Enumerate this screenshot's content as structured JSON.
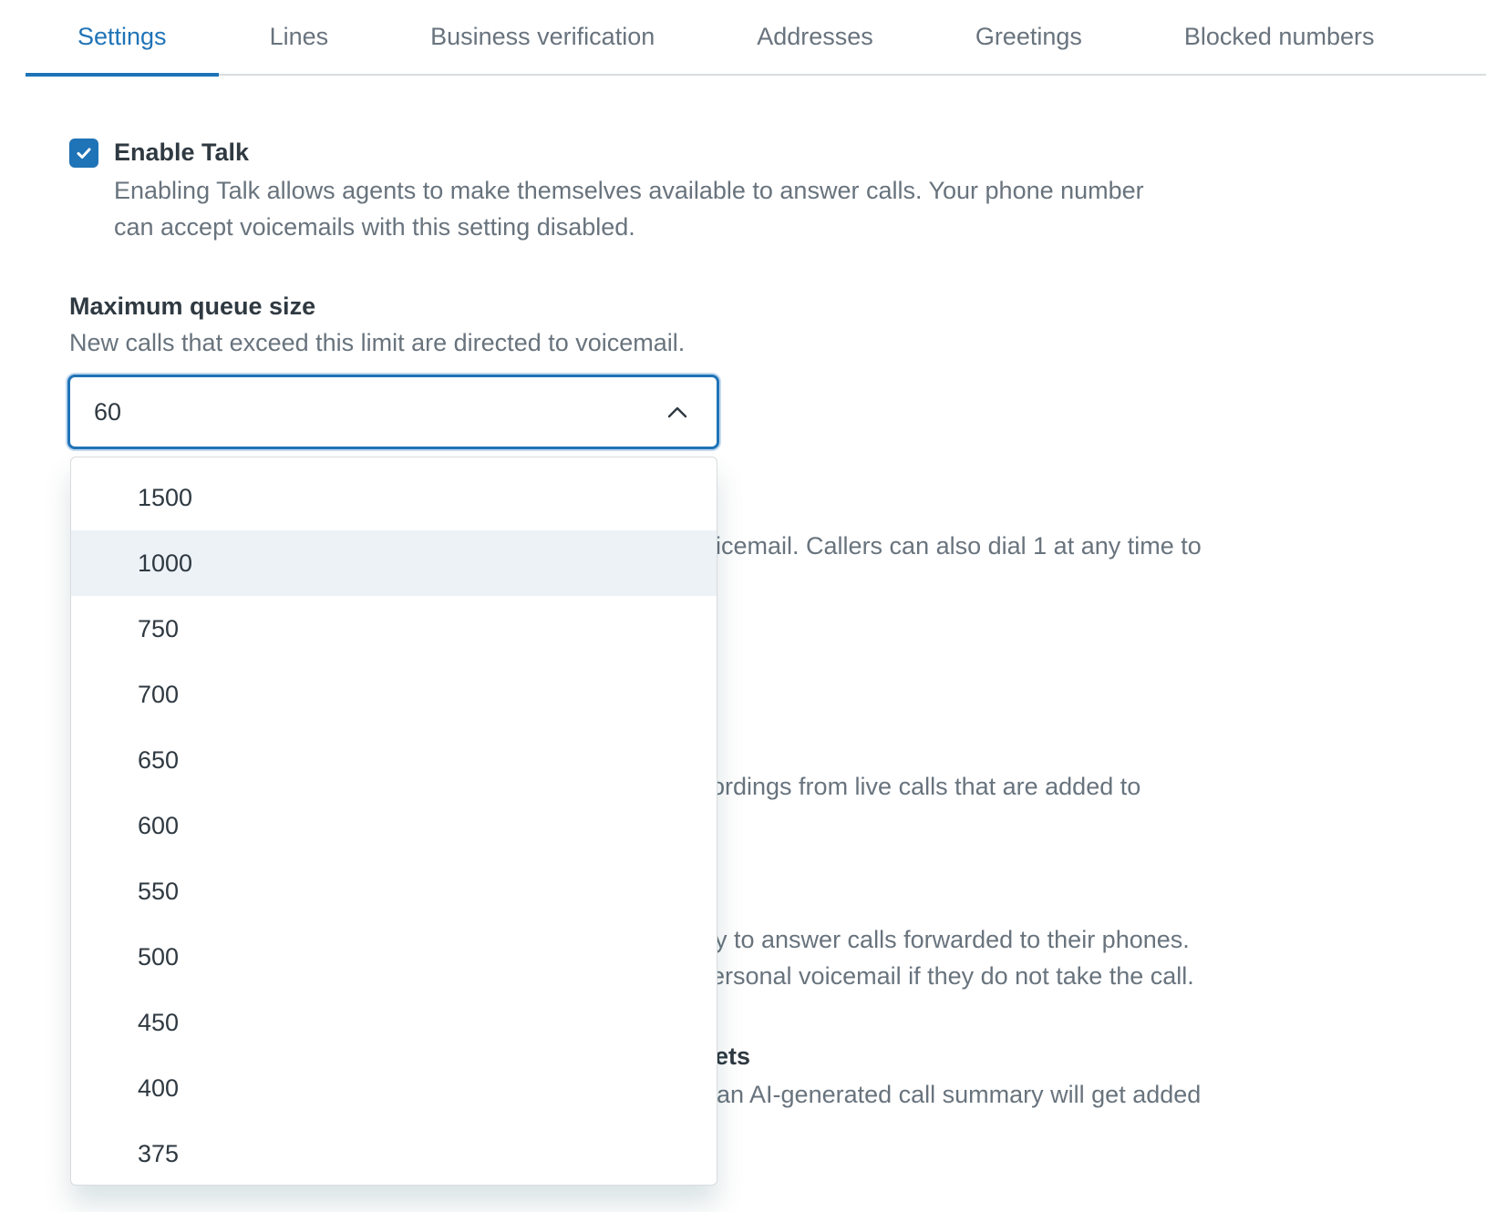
{
  "tabs": [
    {
      "label": "Settings",
      "active": true
    },
    {
      "label": "Lines",
      "active": false
    },
    {
      "label": "Business verification",
      "active": false
    },
    {
      "label": "Addresses",
      "active": false
    },
    {
      "label": "Greetings",
      "active": false
    },
    {
      "label": "Blocked numbers",
      "active": false
    }
  ],
  "enable_talk": {
    "checked": true,
    "title": "Enable Talk",
    "desc_line1": "Enabling Talk allows agents to make themselves available to answer calls. Your phone number",
    "desc_line2": "can accept voicemails with this setting disabled."
  },
  "queue_size": {
    "title": "Maximum queue size",
    "desc": "New calls that exceed this limit are directed to voicemail.",
    "value": "60",
    "options": [
      "1500",
      "1000",
      "750",
      "700",
      "650",
      "600",
      "550",
      "500",
      "450",
      "400",
      "375"
    ],
    "hovered_option": "1000"
  },
  "obscured": {
    "line1": "oicemail. Callers can also dial 1 at any time to",
    "line2": "ordings from live calls that are added to",
    "line3": "y to answer calls forwarded to their phones.",
    "line4": "ersonal voicemail if they do not take the call.",
    "title5": "ets",
    "line6": "an AI-generated call summary will get added"
  },
  "colors": {
    "accent": "#1f73b7",
    "hover_bg": "#edf2f7",
    "muted_text": "#68737d"
  },
  "icons": {
    "checkbox": "check-icon",
    "select": "chevron-up-icon"
  }
}
